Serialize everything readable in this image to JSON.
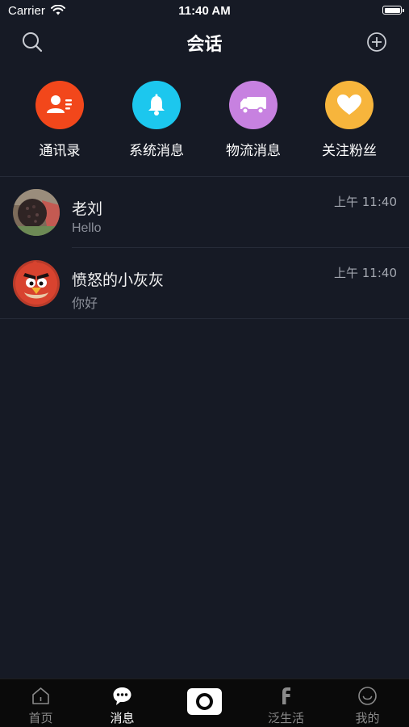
{
  "status_bar": {
    "carrier": "Carrier",
    "time": "11:40 AM"
  },
  "nav": {
    "title": "会话",
    "search_icon": "search-icon",
    "add_icon": "add-circle-icon"
  },
  "quick_actions": [
    {
      "label": "通讯录",
      "icon": "contacts-icon",
      "color": "#f2471b"
    },
    {
      "label": "系统消息",
      "icon": "bell-icon",
      "color": "#1cc7ee"
    },
    {
      "label": "物流消息",
      "icon": "truck-icon",
      "color": "#c781e0"
    },
    {
      "label": "关注粉丝",
      "icon": "heart-icon",
      "color": "#f7b53c"
    }
  ],
  "conversations": [
    {
      "name": "老刘",
      "message": "Hello",
      "time": "上午 11:40",
      "avatar": "photo-avatar"
    },
    {
      "name": "愤怒的小灰灰",
      "message": "你好",
      "time": "上午 11:40",
      "avatar": "angry-bird-avatar"
    }
  ],
  "tabs": [
    {
      "label": "首页",
      "icon": "home-icon",
      "active": false
    },
    {
      "label": "消息",
      "icon": "chat-bubble-icon",
      "active": true
    },
    {
      "label": "",
      "icon": "camera-icon",
      "active": false
    },
    {
      "label": "泛生活",
      "icon": "f-logo-icon",
      "active": false
    },
    {
      "label": "我的",
      "icon": "smile-icon",
      "active": false
    }
  ],
  "colors": {
    "background": "#161a25",
    "tab_bar": "#0a0a0a",
    "divider": "#262b38",
    "secondary_text": "#8b8f99"
  }
}
